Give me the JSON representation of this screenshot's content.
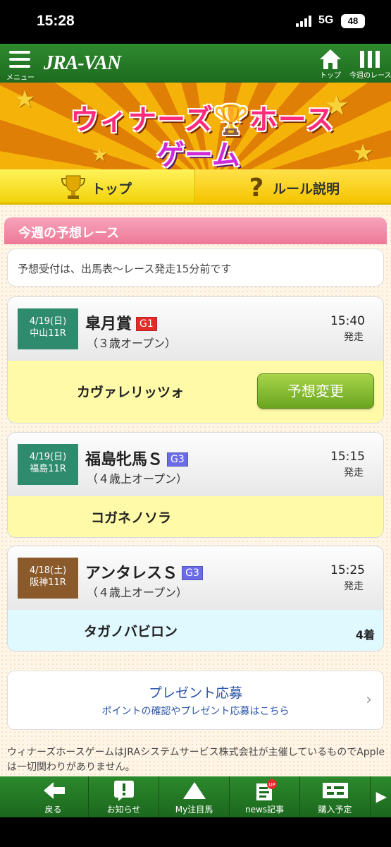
{
  "status_bar": {
    "time": "15:28",
    "network": "5G",
    "battery": "48"
  },
  "header": {
    "menu_label": "メニュー",
    "logo": "JRA-VAN",
    "top_label": "トップ",
    "week_label": "今週のレース"
  },
  "banner": {
    "title_line1": "ウィナーズ🏆ホース",
    "title_line2": "ゲーム"
  },
  "tabs": [
    {
      "label": "トップ"
    },
    {
      "label": "ルール説明"
    }
  ],
  "section": {
    "title": "今週の予想レース",
    "notice": "予想受付は、出馬表〜レース発走15分前です"
  },
  "races": [
    {
      "date": "4/19(日)",
      "venue": "中山11R",
      "name": "皐月賞",
      "grade": "G1",
      "condition": "（３歳オープン）",
      "time": "15:40",
      "start_label": "発走",
      "horse": "カヴァレリッツォ",
      "button": "予想変更",
      "rank": "",
      "date_color": "#2e8b6e",
      "grade_color": "#e52a2a",
      "pick_bg": "#fffaa8"
    },
    {
      "date": "4/19(日)",
      "venue": "福島11R",
      "name": "福島牝馬Ｓ",
      "grade": "G3",
      "condition": "（４歳上オープン）",
      "time": "15:15",
      "start_label": "発走",
      "horse": "コガネノソラ",
      "button": "",
      "rank": "",
      "date_color": "#2e8b6e",
      "grade_color": "#6b6bea",
      "pick_bg": "#fffaa8"
    },
    {
      "date": "4/18(土)",
      "venue": "阪神11R",
      "name": "アンタレスＳ",
      "grade": "G3",
      "condition": "（４歳上オープン）",
      "time": "15:25",
      "start_label": "発走",
      "horse": "タガノバビロン",
      "button": "",
      "rank": "4着",
      "date_color": "#8b5a2b",
      "grade_color": "#6b6bea",
      "pick_bg": "#e0f8ff"
    }
  ],
  "present": {
    "title": "プレゼント応募",
    "subtitle": "ポイントの確認やプレゼント応募はこちら"
  },
  "disclaimer": "ウィナーズホースゲームはJRAシステムサービス株式会社が主催しているものでAppleは一切関わりがありません。",
  "bottom_nav": [
    {
      "label": "戻る",
      "icon": "arrow-left-icon"
    },
    {
      "label": "お知らせ",
      "icon": "notice-icon"
    },
    {
      "label": "My注目馬",
      "icon": "horse-icon"
    },
    {
      "label": "news記事",
      "icon": "news-icon",
      "badge": "UP"
    },
    {
      "label": "購入予定",
      "icon": "ticket-icon"
    }
  ]
}
